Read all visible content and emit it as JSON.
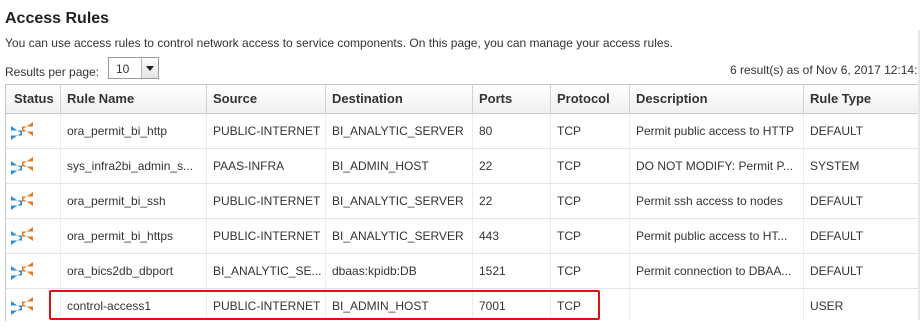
{
  "page": {
    "title": "Access Rules",
    "description": "You can use access rules to control network access to service components. On this page, you can manage your access rules."
  },
  "pagination": {
    "results_per_page_label": "Results per page:",
    "results_per_page_value": "10",
    "results_summary": "6 result(s) as of Nov 6, 2017 12:14:"
  },
  "table": {
    "columns": [
      "Status",
      "Rule Name",
      "Source",
      "Destination",
      "Ports",
      "Protocol",
      "Description",
      "Rule Type"
    ],
    "rows": [
      {
        "status_icon": "access-rule-arrows-icon",
        "rule_name": "ora_permit_bi_http",
        "source": "PUBLIC-INTERNET",
        "destination": "BI_ANALYTIC_SERVER",
        "ports": "80",
        "protocol": "TCP",
        "description": "Permit public access to HTTP",
        "rule_type": "DEFAULT"
      },
      {
        "status_icon": "access-rule-arrows-icon",
        "rule_name": "sys_infra2bi_admin_s...",
        "source": "PAAS-INFRA",
        "destination": "BI_ADMIN_HOST",
        "ports": "22",
        "protocol": "TCP",
        "description": "DO NOT MODIFY: Permit P...",
        "rule_type": "SYSTEM"
      },
      {
        "status_icon": "access-rule-arrows-icon",
        "rule_name": "ora_permit_bi_ssh",
        "source": "PUBLIC-INTERNET",
        "destination": "BI_ANALYTIC_SERVER",
        "ports": "22",
        "protocol": "TCP",
        "description": "Permit ssh access to nodes",
        "rule_type": "DEFAULT"
      },
      {
        "status_icon": "access-rule-arrows-icon",
        "rule_name": "ora_permit_bi_https",
        "source": "PUBLIC-INTERNET",
        "destination": "BI_ANALYTIC_SERVER",
        "ports": "443",
        "protocol": "TCP",
        "description": "Permit public access to HT...",
        "rule_type": "DEFAULT"
      },
      {
        "status_icon": "access-rule-arrows-icon",
        "rule_name": "ora_bics2db_dbport",
        "source": "BI_ANALYTIC_SE...",
        "destination": "dbaas:kpidb:DB",
        "ports": "1521",
        "protocol": "TCP",
        "description": "Permit connection to DBAA...",
        "rule_type": "DEFAULT"
      },
      {
        "status_icon": "access-rule-arrows-icon",
        "rule_name": "control-access1",
        "source": "PUBLIC-INTERNET",
        "destination": "BI_ADMIN_HOST",
        "ports": "7001",
        "protocol": "TCP",
        "description": "",
        "rule_type": "USER"
      }
    ]
  },
  "colors": {
    "icon_orange": "#e8791e",
    "icon_blue": "#2e8fd6",
    "highlight_red": "#dd1111"
  }
}
